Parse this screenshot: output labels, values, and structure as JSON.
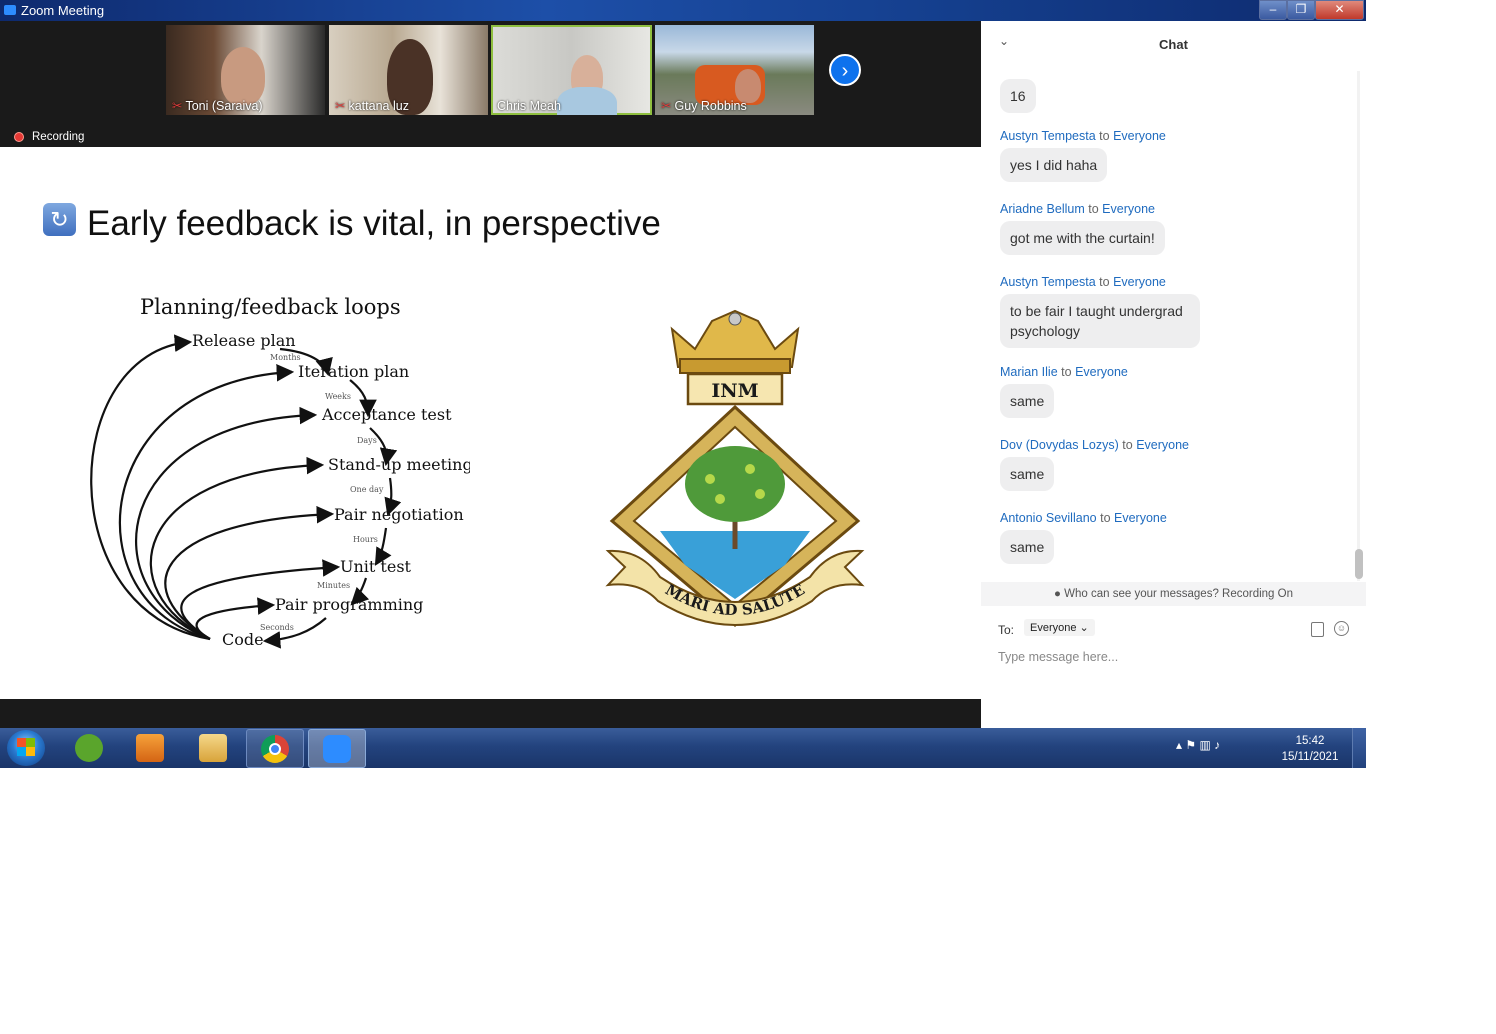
{
  "window": {
    "title": "Zoom Meeting",
    "minimize": "–",
    "restore": "❐",
    "close": "✕"
  },
  "participants": [
    {
      "name": "Toni (Saraiva)",
      "muted": true
    },
    {
      "name": "kattana luz",
      "muted": true
    },
    {
      "name": "Chris Meah",
      "muted": false
    },
    {
      "name": "Guy Robbins",
      "muted": true
    }
  ],
  "mic_muted_icon": "✂",
  "next_arrow": "›",
  "recording": {
    "label": "Recording"
  },
  "slide": {
    "title": "Early feedback is vital, in perspective",
    "icon": "↻",
    "diagram": {
      "heading": "Planning/feedback loops",
      "steps": [
        "Release plan",
        "Iteration plan",
        "Acceptance test",
        "Stand-up meeting",
        "Pair negotiation",
        "Unit test",
        "Pair programming",
        "Code"
      ],
      "intervals": [
        "Months",
        "Weeks",
        "Days",
        "One day",
        "Hours",
        "Minutes",
        "Seconds"
      ]
    },
    "crest": {
      "banner_top": "INM",
      "motto": "E MARI AD SALUTEM"
    }
  },
  "chat": {
    "title": "Chat",
    "collapse_icon": "⌄",
    "messages": [
      {
        "sender": "",
        "to": "",
        "recipient": "",
        "text": "16"
      },
      {
        "sender": "Austyn Tempesta",
        "to": "to",
        "recipient": "Everyone",
        "text": "yes I did haha"
      },
      {
        "sender": "Ariadne Bellum",
        "to": "to",
        "recipient": "Everyone",
        "text": "got me with the curtain!"
      },
      {
        "sender": "Austyn Tempesta",
        "to": "to",
        "recipient": "Everyone",
        "text": "to be fair I taught undergrad psychology"
      },
      {
        "sender": "Marian Ilie",
        "to": "to",
        "recipient": "Everyone",
        "text": "same"
      },
      {
        "sender": "Dov (Dovydas Lozys)",
        "to": "to",
        "recipient": "Everyone",
        "text": "same"
      },
      {
        "sender": "Antonio Sevillano",
        "to": "to",
        "recipient": "Everyone",
        "text": "same"
      }
    ],
    "visibility_note": "Who can see your messages? Recording On",
    "to_label": "To:",
    "to_value": "Everyone",
    "to_dropdown_icon": "⌄",
    "input_placeholder": "Type message here...",
    "emoji_icon": "☺"
  },
  "taskbar": {
    "apps": [
      "start",
      "evernote",
      "media-player",
      "file-explorer",
      "chrome",
      "zoom"
    ],
    "tray_icons": "▴  ⚑  ▥  ♪",
    "time": "15:42",
    "date": "15/11/2021"
  }
}
